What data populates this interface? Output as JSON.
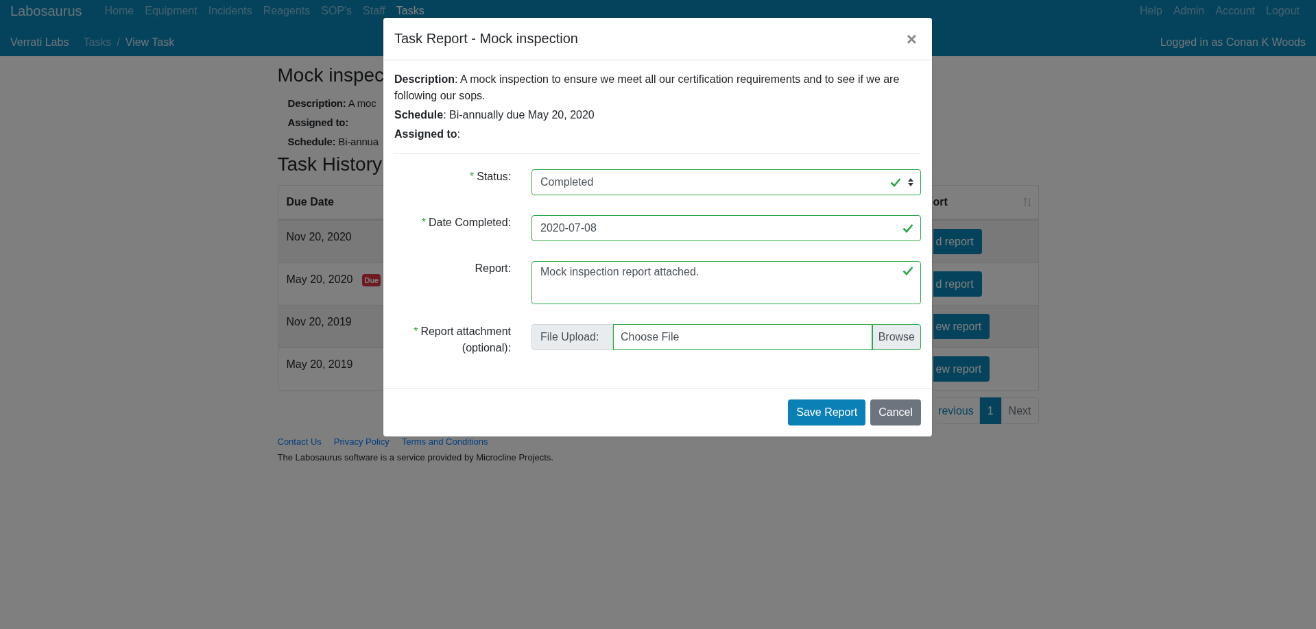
{
  "navbar": {
    "brand": "Labosaurus",
    "links": [
      {
        "label": "Home",
        "selected": false
      },
      {
        "label": "Equipment",
        "selected": false
      },
      {
        "label": "Incidents",
        "selected": false
      },
      {
        "label": "Reagents",
        "selected": false
      },
      {
        "label": "SOP's",
        "selected": false
      },
      {
        "label": "Staff",
        "selected": false
      },
      {
        "label": "Tasks",
        "selected": true
      }
    ],
    "right_links": [
      "Help",
      "Admin",
      "Account",
      "Logout"
    ],
    "lab_name": "Verrati Labs",
    "breadcrumb": [
      {
        "label": "Tasks",
        "current": false
      },
      {
        "label": "View Task",
        "current": true
      }
    ],
    "breadcrumb_separator": "/",
    "user_text": "Logged in as Conan K Woods"
  },
  "page": {
    "title": "Mock inspec",
    "details": [
      "**Description:** A moc",
      "**Assigned to:**",
      "**Schedule:** Bi-annua"
    ],
    "history_title": "Task History",
    "table": {
      "columns": [
        "Due Date",
        "ort"
      ],
      "rows": [
        {
          "due_date": "Nov 20, 2020",
          "action": "d report"
        },
        {
          "due_date": "May 20, 2020",
          "badge": "Due",
          "action": "d report"
        },
        {
          "due_date": "Nov 20, 2019",
          "action": "ew report"
        },
        {
          "due_date": "May 20, 2019",
          "action": "ew report"
        }
      ]
    },
    "pagination": [
      {
        "label": "revious",
        "selected": false
      },
      {
        "label": "1",
        "selected": true
      },
      {
        "label": "Next",
        "selected": false
      }
    ],
    "footer": {
      "links": [
        "Contact Us",
        "Privacy Policy",
        "Terms and Conditions"
      ],
      "text": "The Labosaurus software is a service provided by Microcline Projects."
    }
  },
  "modal": {
    "title": "Task Report - Mock inspection",
    "close": "×",
    "details": [
      "**Description**: A mock inspection to ensure we meet all our certification requirements and to see if we are following our sops.",
      "**Schedule**: Bi-annually due May 20, 2020",
      "**Assigned to**:"
    ],
    "required_mark": "*",
    "fields": [
      {
        "kind": "select",
        "label": "Status:",
        "required": true,
        "valid": true,
        "value": "Completed"
      },
      {
        "kind": "input",
        "label": "Date Completed:",
        "required": true,
        "valid": true,
        "value": "2020-07-08"
      },
      {
        "kind": "textarea",
        "label": "Report:",
        "required": false,
        "valid": true,
        "value": "Mock inspection report attached."
      },
      {
        "kind": "file",
        "label": "Report attachment (optional):",
        "required": true,
        "valid": true,
        "addon": "File Upload:",
        "value": "Choose File",
        "button": "Browse"
      }
    ],
    "buttons": [
      {
        "kind": "primary",
        "label": "Save Report"
      },
      {
        "kind": "secondary",
        "label": "Cancel"
      }
    ]
  }
}
